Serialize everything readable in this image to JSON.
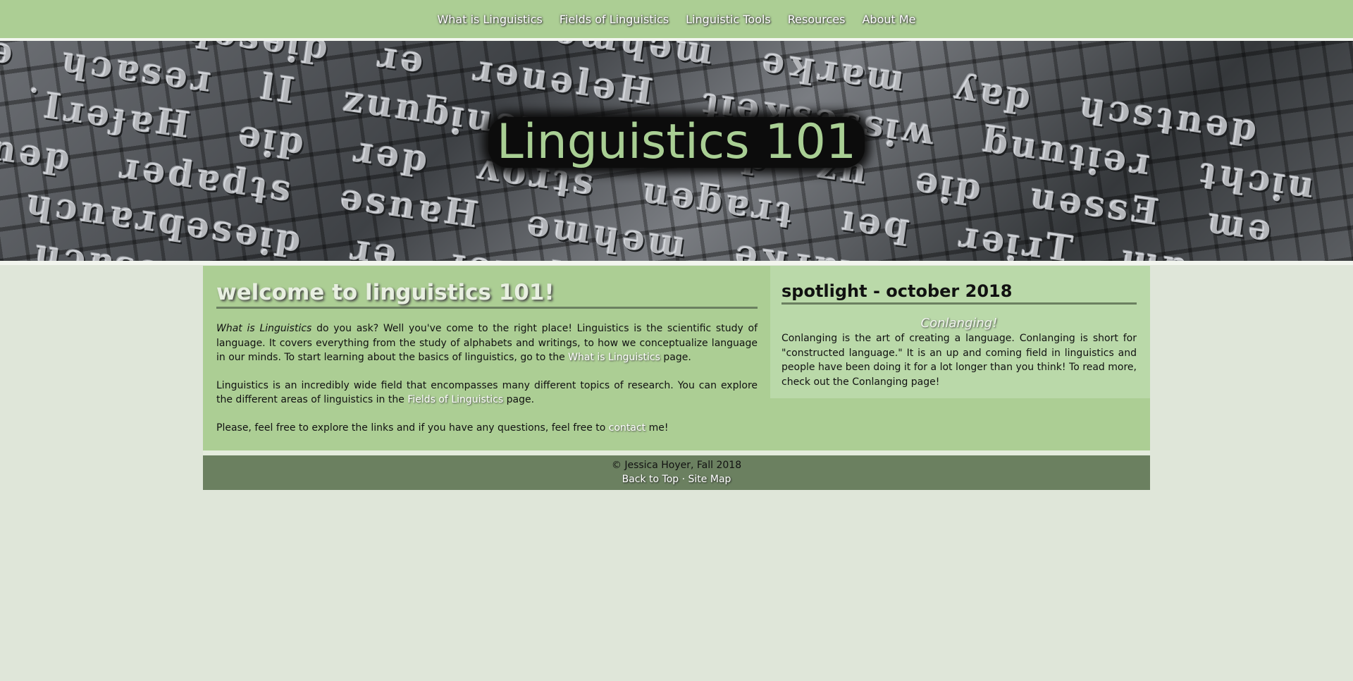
{
  "nav": {
    "items": [
      {
        "label": "What is Linguistics"
      },
      {
        "label": "Fields of Linguistics"
      },
      {
        "label": "Linguistic Tools"
      },
      {
        "label": "Resources"
      },
      {
        "label": "About Me"
      }
    ]
  },
  "hero": {
    "title": "Linguistics 101"
  },
  "main": {
    "heading": "welcome to linguistics 101!",
    "p1": {
      "italic": "What is Linguistics",
      "text_a": " do you ask? Well you've come to the right place! Linguistics is the scientific study of language. It covers everything from the study of alphabets and writings, to how we conceptualize language in our minds. To start learning about the basics of linguistics, go to the ",
      "link": "What is Linguistics",
      "text_b": " page."
    },
    "p2": {
      "text_a": "Linguistics is an incredibly wide field that encompasses many different topics of research. You can explore the different areas of linguistics in the ",
      "link": "Fields of Linguistics",
      "text_b": " page."
    },
    "p3": {
      "text_a": "Please, feel free to explore the links and if you have any questions, feel free to ",
      "link": "contact",
      "text_b": " me!"
    }
  },
  "spotlight": {
    "heading": "spotlight - october 2018",
    "subheading": "Conlanging!",
    "text": "Conlanging is the art of creating a language. Conlanging is short for \"constructed language.\" It is an up and coming field in linguistics and people have been doing it for a lot longer than you think! To read more, check out the Conlanging page!"
  },
  "footer": {
    "copyright": "© Jessica Hoyer, Fall 2018",
    "back_to_top": "Back to Top",
    "separator": "·",
    "site_map": "Site Map"
  },
  "colors": {
    "nav_bg": "#acce94",
    "page_bg": "#dfe6d9",
    "footer_bg": "#6b8060",
    "spotlight_bg": "#bad9a9"
  }
}
